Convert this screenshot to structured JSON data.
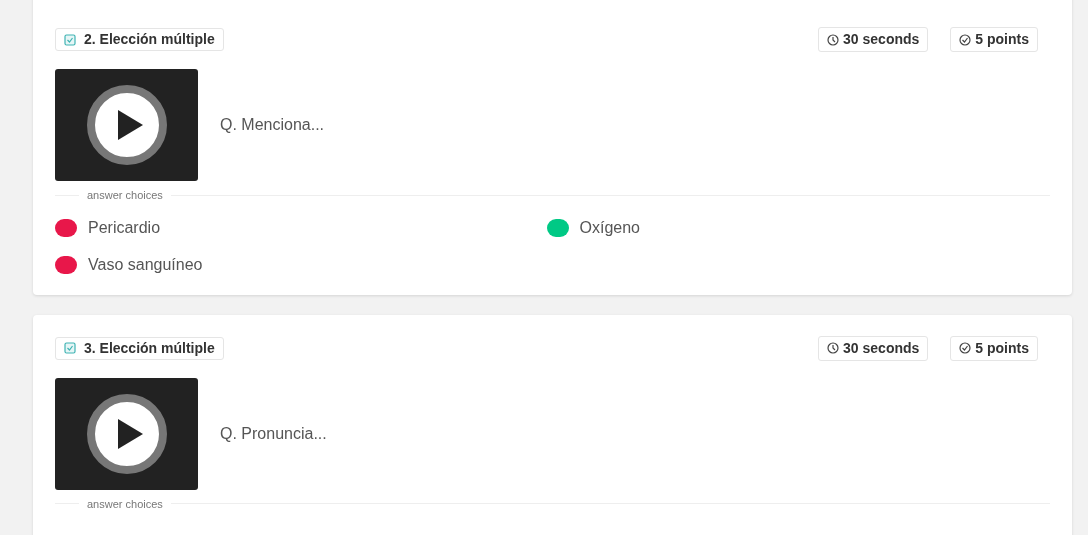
{
  "questions": [
    {
      "number_type": "2. Elección múltiple",
      "time": "30 seconds",
      "points": "5 points",
      "question": "Q. Menciona...",
      "choices_label": "answer choices",
      "choices": [
        {
          "text": "Pericardio",
          "correct": false
        },
        {
          "text": "Oxígeno",
          "correct": true
        },
        {
          "text": "Vaso sanguíneo",
          "correct": false
        }
      ]
    },
    {
      "number_type": "3. Elección múltiple",
      "time": "30 seconds",
      "points": "5 points",
      "question": "Q. Pronuncia...",
      "choices_label": "answer choices"
    }
  ]
}
